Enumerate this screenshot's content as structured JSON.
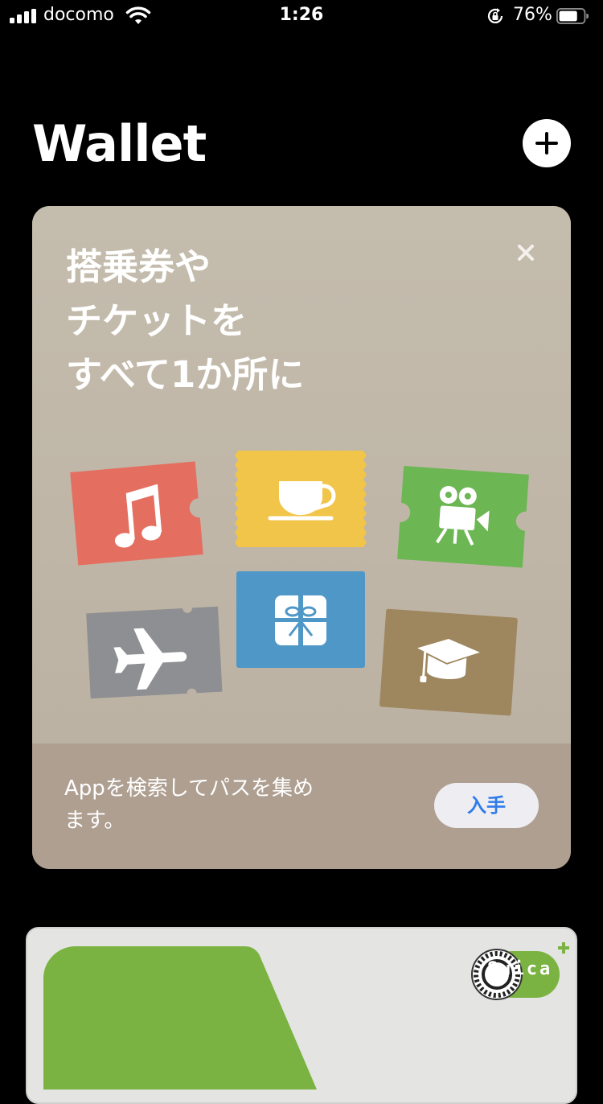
{
  "status_bar": {
    "carrier": "docomo",
    "time": "1:26",
    "battery_percent": "76%",
    "battery_level": 0.76,
    "icons": [
      "signal-icon",
      "wifi-icon",
      "orientation-lock-icon",
      "battery-icon"
    ]
  },
  "header": {
    "title": "Wallet",
    "add_icon": "plus-icon"
  },
  "promo_card": {
    "headline": "搭乗券や\nチケットを\nすべて1か所に",
    "close_icon": "close-icon",
    "ticket_icons": [
      "music-note-icon",
      "coffee-cup-icon",
      "movie-camera-icon",
      "airplane-icon",
      "gift-icon",
      "graduation-cap-icon"
    ],
    "ticket_colors": {
      "music": "#e46f60",
      "coffee": "#f1c44a",
      "movie": "#6cb653",
      "airplane": "#8e8f92",
      "gift": "#4e97c7",
      "graduation": "#9e865e"
    },
    "description": "Appを検索してパスを集めます。",
    "get_button": "入手",
    "accent_color": "#2f7bea"
  },
  "suica_card": {
    "brand_text": "Suica",
    "brand_color": "#7ab341"
  }
}
